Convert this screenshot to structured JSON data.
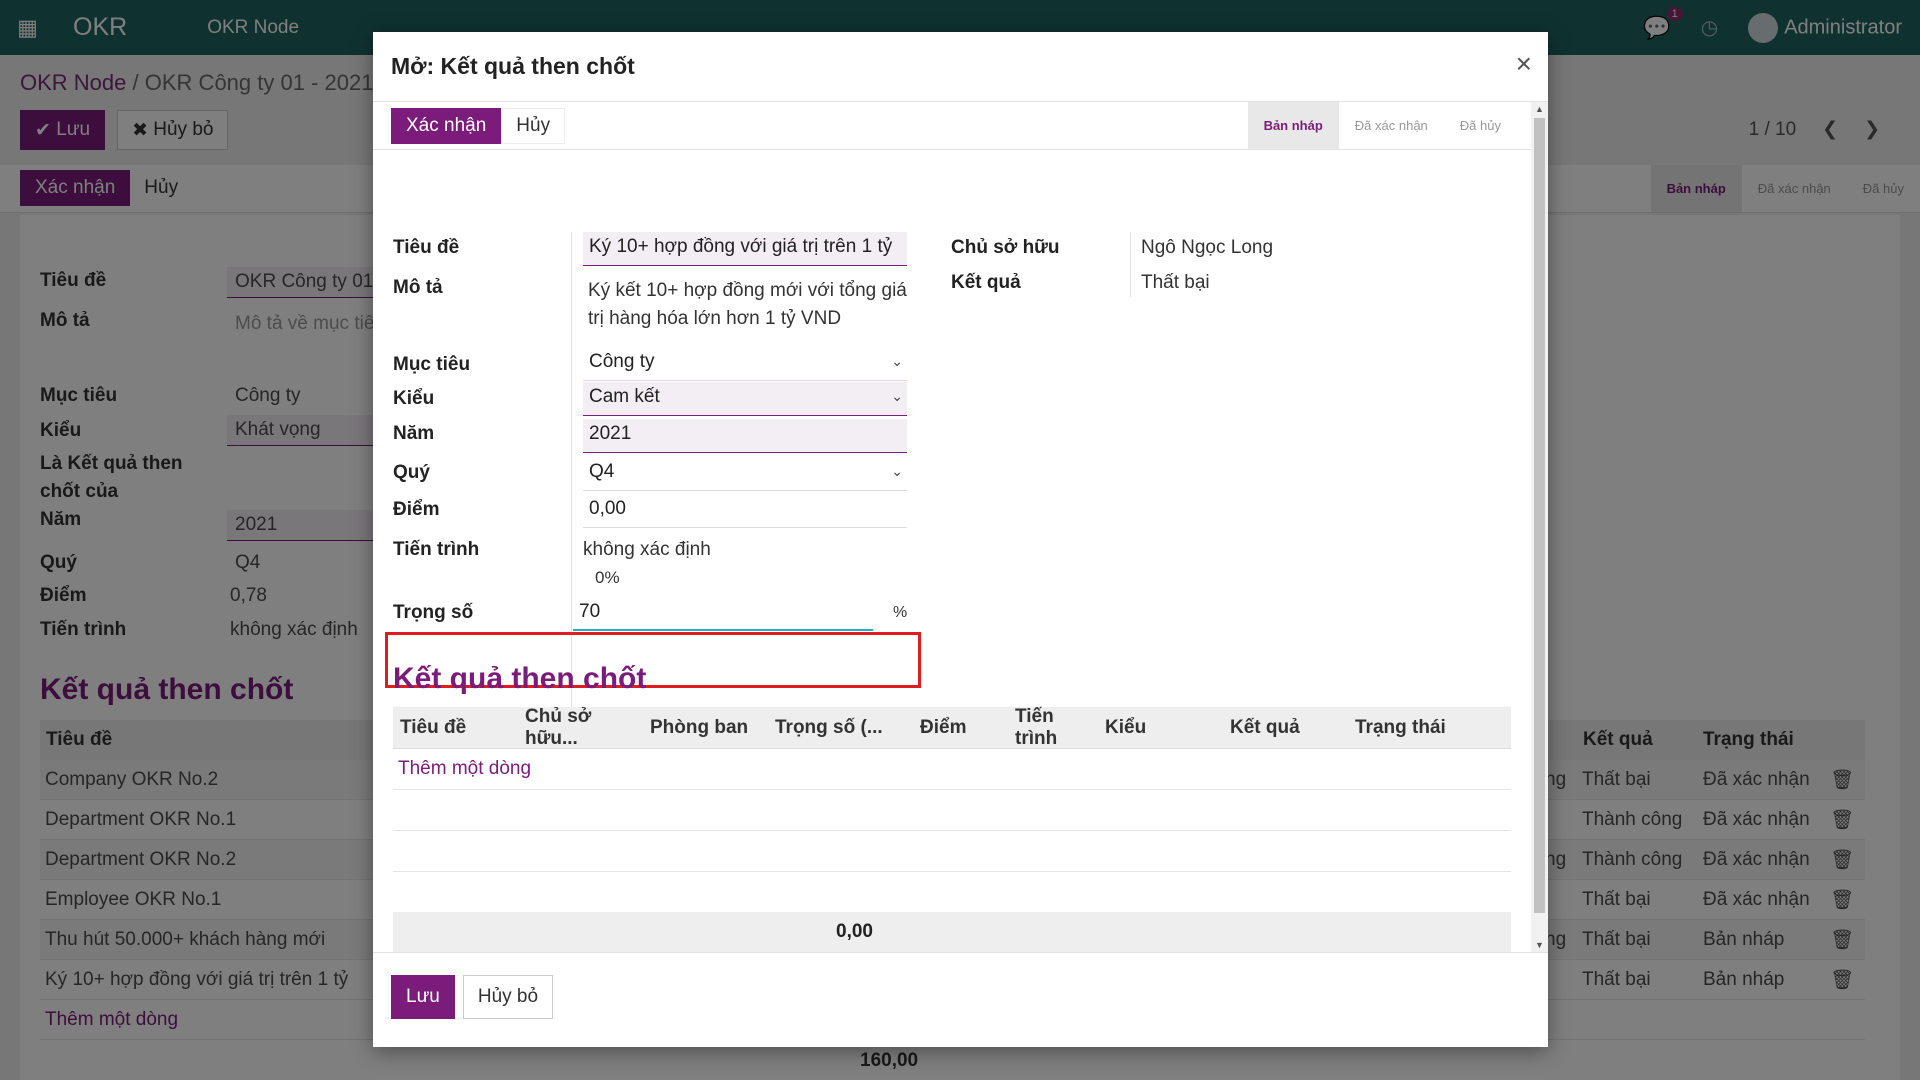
{
  "navbar": {
    "brand": "OKR",
    "menu": "OKR Node",
    "chat_badge": "1",
    "user": "Administrator"
  },
  "background": {
    "breadcrumb_link": "OKR Node",
    "breadcrumb_sep": "/",
    "breadcrumb_current": "OKR Công ty 01 - 2021/(",
    "save": "Lưu",
    "discard": "Hủy bỏ",
    "confirm": "Xác nhận",
    "cancel": "Hủy",
    "pager": "1 / 10",
    "status": [
      "Bản nháp",
      "Đã xác nhận",
      "Đã hủy"
    ],
    "labels": {
      "title": "Tiêu đề",
      "desc": "Mô tả",
      "objective": "Mục tiêu",
      "type": "Kiểu",
      "is_kr_of_1": "Là Kết quả then",
      "is_kr_of_2": "chốt của",
      "year": "Năm",
      "quarter": "Quý",
      "score": "Điểm",
      "progress": "Tiến trình"
    },
    "values": {
      "title": "OKR Công ty 01",
      "desc": "Mô tả về mục tiê",
      "objective": "Công ty",
      "type": "Khát vọng",
      "year": "2021",
      "quarter": "Q4",
      "score": "0,78",
      "progress": "không xác định"
    },
    "section_title": "Kết quả then chốt",
    "table_headers": [
      "Tiêu đề",
      "Kết quả",
      "Trạng thái"
    ],
    "rows": [
      {
        "title": "Company OKR No.2",
        "partial": "ng",
        "result": "Thất bại",
        "state": "Đã xác nhận"
      },
      {
        "title": "Department OKR No.1",
        "partial": "",
        "result": "Thành công",
        "state": "Đã xác nhận"
      },
      {
        "title": "Department OKR No.2",
        "partial": "ng",
        "result": "Thành công",
        "state": "Đã xác nhận"
      },
      {
        "title": "Employee OKR No.1",
        "partial": "",
        "result": "Thất bại",
        "state": "Đã xác nhận"
      },
      {
        "title": "Thu hút 50.000+ khách hàng mới",
        "partial": "ng",
        "result": "Thất bại",
        "state": "Bản nháp"
      },
      {
        "title": "Ký 10+ hợp đồng với giá trị trên 1 tỷ",
        "partial": "",
        "result": "Thất bại",
        "state": "Bản nháp"
      }
    ],
    "add_line": "Thêm một dòng",
    "total": "160,00"
  },
  "modal": {
    "title": "Mở: Kết quả then chốt",
    "confirm": "Xác nhận",
    "cancel": "Hủy",
    "status": [
      "Bản nháp",
      "Đã xác nhận",
      "Đã hủy"
    ],
    "labels": {
      "title": "Tiêu đề",
      "desc": "Mô tả",
      "objective": "Mục tiêu",
      "type": "Kiểu",
      "year": "Năm",
      "quarter": "Quý",
      "score": "Điểm",
      "progress": "Tiến trình",
      "weight": "Trọng số",
      "owner": "Chủ sở hữu",
      "result": "Kết quả"
    },
    "values": {
      "title": "Ký 10+ hợp đồng với giá trị trên 1 tỷ",
      "desc_1": "Ký kết 10+ hợp đồng mới với tổng giá",
      "desc_2": "trị hàng hóa lớn hơn 1 tỷ VND",
      "objective": "Công ty",
      "type": "Cam kết",
      "year": "2021",
      "quarter": "Q4",
      "score": "0,00",
      "progress": "không xác định",
      "progress_pct": "0%",
      "weight": "70",
      "weight_unit": "%",
      "owner": "Ngô Ngọc Long",
      "result": "Thất bại"
    },
    "section_title": "Kết quả then chốt",
    "table_headers": [
      "Tiêu đề",
      "Chủ sở hữu...",
      "Phòng ban",
      "Trọng số (...",
      "Điểm",
      "Tiến trình",
      "Kiểu",
      "Kết quả",
      "Trạng thái"
    ],
    "add_line": "Thêm một dòng",
    "total": "0,00",
    "save": "Lưu",
    "discard": "Hủy bỏ"
  }
}
